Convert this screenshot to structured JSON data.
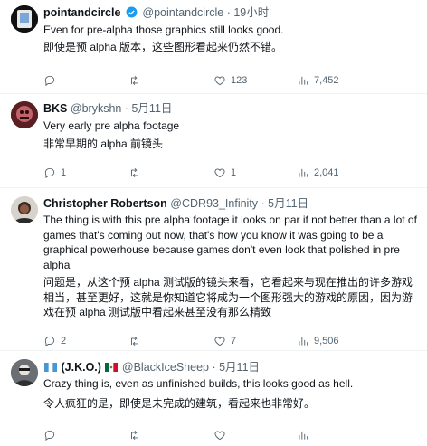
{
  "tweets": [
    {
      "name": "pointandcircle",
      "handle": "@pointandcircle",
      "time": "· 19小时",
      "text_en": "Even for pre-alpha those graphics still looks good.",
      "text_zh": "即使是预 alpha 版本，这些图形看起来仍然不错。",
      "replies": "",
      "retweets": "",
      "likes": "123",
      "views": "7,452"
    },
    {
      "name": "BKS",
      "handle": "@brykshn",
      "time": "· 5月11日",
      "text_en": "Very early pre alpha footage",
      "text_zh": "非常早期的 alpha 前镜头",
      "replies": "1",
      "retweets": "",
      "likes": "1",
      "views": "2,041"
    },
    {
      "name": "Christopher Robertson",
      "handle": "@CDR93_Infinity",
      "time": "· 5月11日",
      "text_en": "The thing is with this pre alpha footage it looks on par if not better than a lot of games that's coming out now, that's how you know it was going to be a graphical powerhouse because games don't even look that polished in pre alpha",
      "text_zh": "问题是，从这个预 alpha 测试版的镜头来看，它看起来与现在推出的许多游戏相当，甚至更好，这就是你知道它将成为一个图形强大的游戏的原因，因为游戏在预 alpha 测试版中看起来甚至没有那么精致",
      "replies": "2",
      "retweets": "",
      "likes": "7",
      "views": "9,506"
    },
    {
      "name": "(J.K.O.)",
      "handle": "@BlackIceSheep",
      "time": "· 5月11日",
      "text_en": "Crazy thing is, even as unfinished builds, this looks good as hell.",
      "text_zh": "令人疯狂的是，即使是未完成的建筑，看起来也非常好。",
      "replies": "",
      "retweets": "",
      "likes": "",
      "views": ""
    }
  ],
  "colors": {
    "text": "#0f1419",
    "muted": "#536471",
    "verified": "#1d9bf0",
    "divider": "#eff3f4"
  },
  "icons": [
    "reply-icon",
    "retweet-icon",
    "like-icon",
    "views-icon",
    "verified-badge-icon"
  ]
}
